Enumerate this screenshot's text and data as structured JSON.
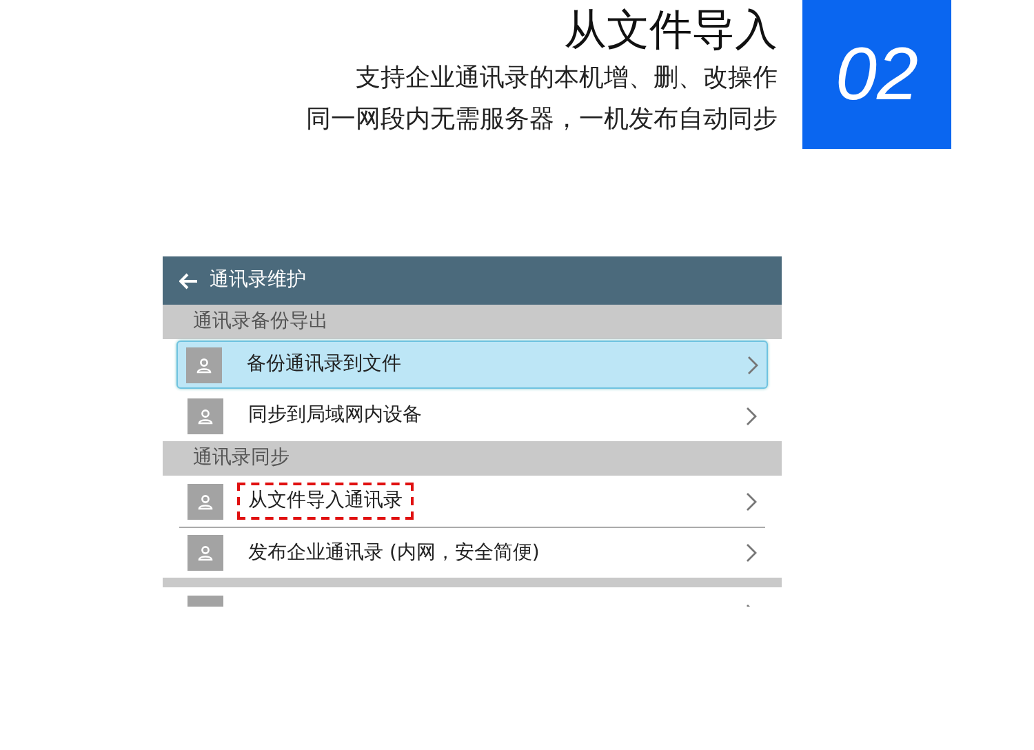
{
  "banner": {
    "title": "从文件导入",
    "lines": [
      "支持企业通讯录的本机增、删、改操作",
      "同一网段内无需服务器，一机发布自动同步"
    ],
    "number": "02"
  },
  "phone": {
    "app_bar": {
      "title": "通讯录维护"
    },
    "sections": [
      {
        "title": "通讯录备份导出",
        "items": [
          {
            "label": "备份通讯录到文件",
            "selected": true,
            "highlighted": false
          },
          {
            "label": "同步到局域网内设备",
            "selected": false,
            "highlighted": false
          }
        ]
      },
      {
        "title": "通讯录同步",
        "items": [
          {
            "label": "从文件导入通讯录",
            "selected": false,
            "highlighted": true
          },
          {
            "label": "发布企业通讯录 (内网，安全简便)",
            "selected": false,
            "highlighted": false
          }
        ]
      },
      {
        "items": [
          {
            "selected": false
          }
        ]
      }
    ]
  }
}
